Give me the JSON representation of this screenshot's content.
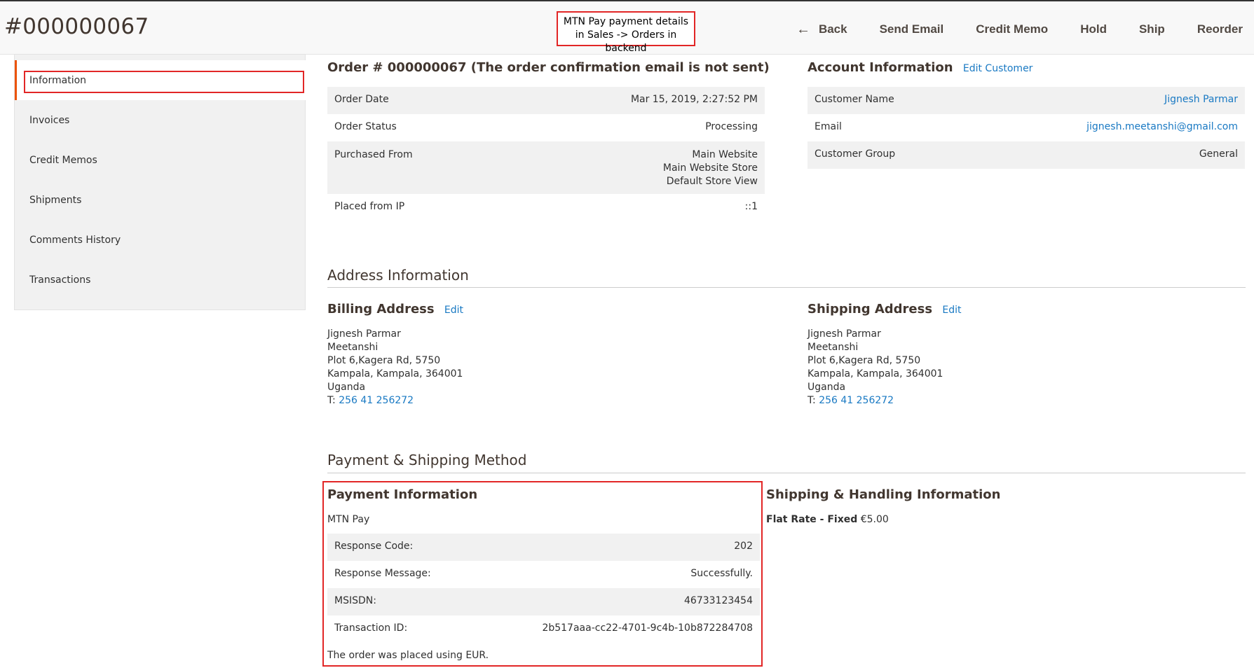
{
  "header": {
    "title": "#000000067",
    "callout": "MTN Pay payment details in Sales -> Orders in backend",
    "actions": {
      "back": "Back",
      "send_email": "Send Email",
      "credit_memo": "Credit Memo",
      "hold": "Hold",
      "ship": "Ship",
      "reorder": "Reorder"
    }
  },
  "sidebar": {
    "items": [
      {
        "label": "Information"
      },
      {
        "label": "Invoices"
      },
      {
        "label": "Credit Memos"
      },
      {
        "label": "Shipments"
      },
      {
        "label": "Comments History"
      },
      {
        "label": "Transactions"
      }
    ]
  },
  "order": {
    "title": "Order # 000000067 (The order confirmation email is not sent)",
    "rows": {
      "date_label": "Order Date",
      "date_value": "Mar 15, 2019, 2:27:52 PM",
      "status_label": "Order Status",
      "status_value": "Processing",
      "purchased_label": "Purchased From",
      "purchased_line1": "Main Website",
      "purchased_line2": "Main Website Store",
      "purchased_line3": "Default Store View",
      "ip_label": "Placed from IP",
      "ip_value": "::1"
    }
  },
  "account": {
    "title": "Account Information",
    "edit_link": "Edit Customer",
    "name_label": "Customer Name",
    "name_value": "Jignesh Parmar",
    "email_label": "Email",
    "email_value": "jignesh.meetanshi@gmail.com",
    "group_label": "Customer Group",
    "group_value": "General"
  },
  "address_info": {
    "title": "Address Information",
    "billing": {
      "title": "Billing Address",
      "edit": "Edit",
      "name": "Jignesh Parmar",
      "company": "Meetanshi",
      "street": "Plot 6,Kagera Rd, 5750",
      "city": "Kampala, Kampala, 364001",
      "country": "Uganda",
      "phone_prefix": "T: ",
      "phone": "256 41 256272"
    },
    "shipping": {
      "title": "Shipping Address",
      "edit": "Edit",
      "name": "Jignesh Parmar",
      "company": "Meetanshi",
      "street": "Plot 6,Kagera Rd, 5750",
      "city": "Kampala, Kampala, 364001",
      "country": "Uganda",
      "phone_prefix": "T: ",
      "phone": "256 41 256272"
    }
  },
  "payment_shipping": {
    "title": "Payment & Shipping Method",
    "payment": {
      "title": "Payment Information",
      "method": "MTN Pay",
      "response_code_label": "Response Code:",
      "response_code_value": "202",
      "response_message_label": "Response Message:",
      "response_message_value": "Successfully.",
      "msisdn_label": "MSISDN:",
      "msisdn_value": "46733123454",
      "transaction_label": "Transaction ID:",
      "transaction_value": "2b517aaa-cc22-4701-9c4b-10b872284708",
      "currency_note": "The order was placed using EUR."
    },
    "shipping": {
      "title": "Shipping & Handling Information",
      "method_bold": "Flat Rate - Fixed",
      "price": "€5.00"
    }
  },
  "colors": {
    "accent": "#eb5202",
    "link": "#1979c3",
    "highlight": "#e22626",
    "row_bg": "#f1f1f1"
  }
}
